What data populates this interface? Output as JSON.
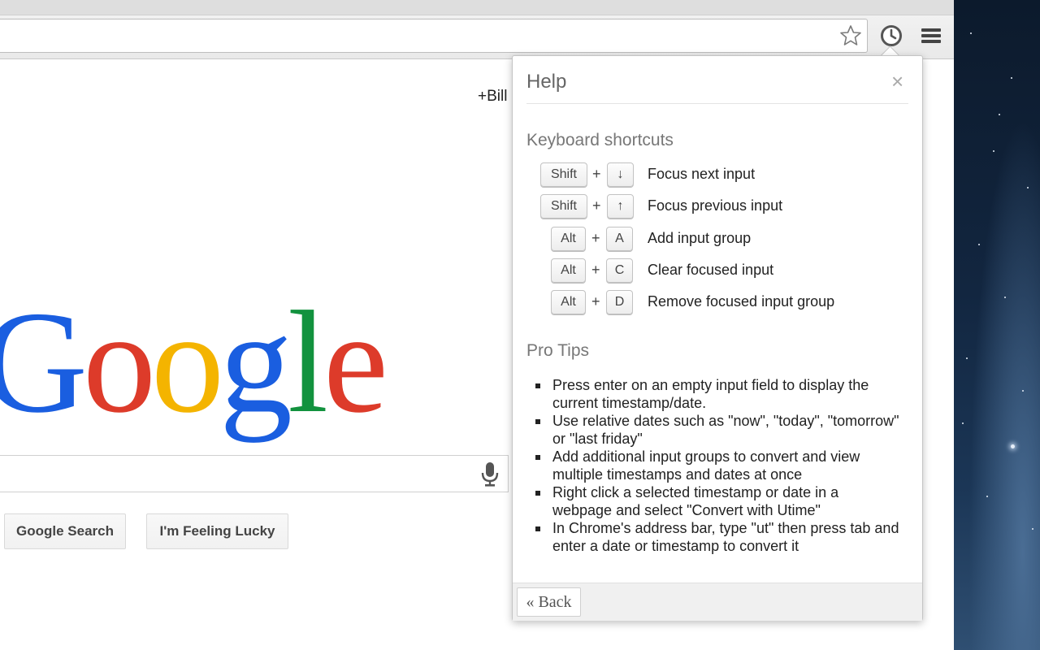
{
  "toolbar": {
    "bookmark_icon": "star-outline-icon",
    "extension_icon": "clock-icon",
    "menu_icon": "hamburger-menu-icon"
  },
  "google": {
    "user_link": "+Bill",
    "logo_letters": [
      {
        "char": "G",
        "color": "#1a5ee0"
      },
      {
        "char": "o",
        "color": "#dd3b2a"
      },
      {
        "char": "o",
        "color": "#f4b400"
      },
      {
        "char": "g",
        "color": "#1a5ee0"
      },
      {
        "char": "l",
        "color": "#12923e"
      },
      {
        "char": "e",
        "color": "#dd3b2a"
      }
    ],
    "search_button": "Google Search",
    "lucky_button": "I'm Feeling Lucky",
    "mic_icon": "microphone-icon"
  },
  "help": {
    "title": "Help",
    "close": "×",
    "shortcuts_title": "Keyboard shortcuts",
    "shortcuts": [
      {
        "mod": "Shift",
        "plus": "+",
        "key": "↓",
        "desc": "Focus next input"
      },
      {
        "mod": "Shift",
        "plus": "+",
        "key": "↑",
        "desc": "Focus previous input"
      },
      {
        "mod": "Alt",
        "plus": "+",
        "key": "A",
        "desc": "Add input group"
      },
      {
        "mod": "Alt",
        "plus": "+",
        "key": "C",
        "desc": "Clear focused input"
      },
      {
        "mod": "Alt",
        "plus": "+",
        "key": "D",
        "desc": "Remove focused input group"
      }
    ],
    "tips_title": "Pro Tips",
    "tips": [
      "Press enter on an empty input field to display the current timestamp/date.",
      "Use relative dates such as \"now\", \"today\", \"tomorrow\" or \"last friday\"",
      "Add additional input groups to convert and view multiple timestamps and dates at once",
      "Right click a selected timestamp or date in a webpage and select \"Convert with Utime\"",
      "In Chrome's address bar, type \"ut\" then press tab and enter a date or timestamp to convert it"
    ],
    "back_button": "« Back"
  },
  "colors": {
    "accent_blue": "#1a5ee0",
    "popup_border": "#c4c4c4",
    "footer_bg": "#f0f0f0"
  }
}
